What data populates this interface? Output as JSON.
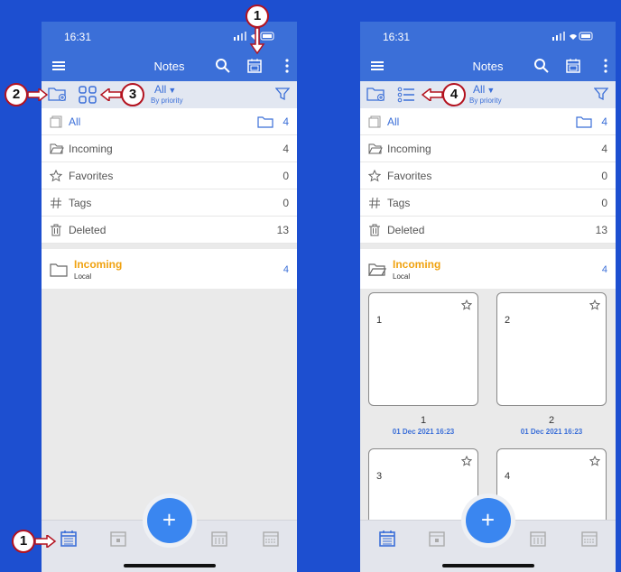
{
  "status": {
    "time": "16:31"
  },
  "appbar": {
    "title": "Notes"
  },
  "toolbar": {
    "filter": "All",
    "sort": "By priority"
  },
  "sidebar": {
    "items": [
      {
        "label": "All",
        "count": "4"
      },
      {
        "label": "Incoming",
        "count": "4"
      },
      {
        "label": "Favorites",
        "count": "0"
      },
      {
        "label": "Tags",
        "count": "0"
      },
      {
        "label": "Deleted",
        "count": "13"
      }
    ]
  },
  "folder": {
    "name": "Incoming",
    "location": "Local",
    "count": "4"
  },
  "notes": [
    {
      "title": "1",
      "caption": "1",
      "date": "01 Dec 2021 16:23"
    },
    {
      "title": "2",
      "caption": "2",
      "date": "01 Dec 2021 16:23"
    },
    {
      "title": "3"
    },
    {
      "title": "4"
    }
  ],
  "fab": {
    "label": "+"
  },
  "callouts": [
    "1",
    "2",
    "3",
    "1",
    "4"
  ],
  "colors": {
    "accent": "#3b6fd8",
    "background": "#1d4fd0",
    "folder_name": "#f0a210",
    "callout_border": "#b3121f"
  }
}
